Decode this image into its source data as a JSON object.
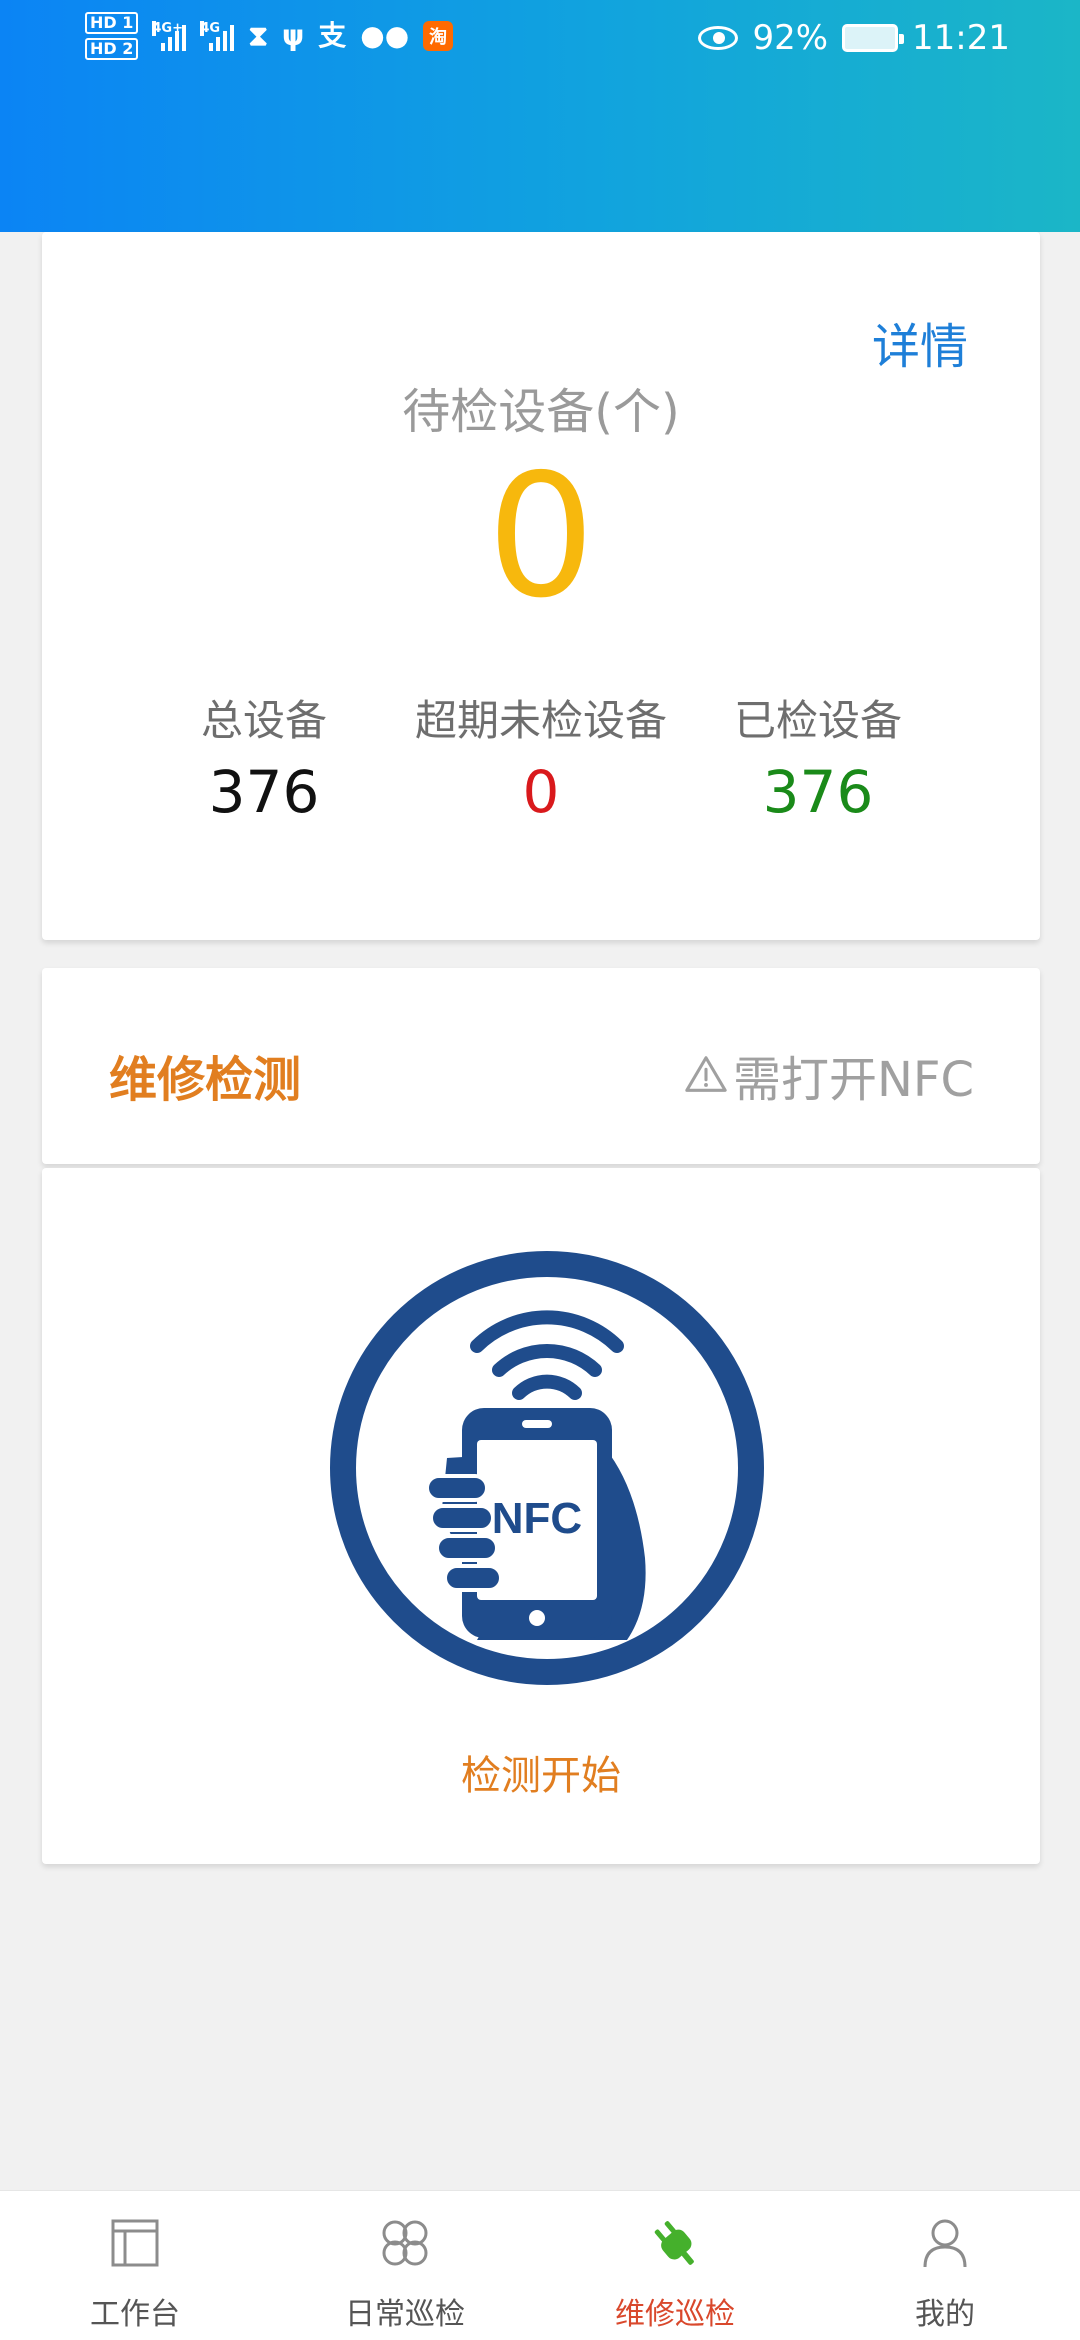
{
  "status_bar": {
    "sim1": "HD 1",
    "sim2": "HD 2",
    "signal1_label": "4G+",
    "signal2_label": "4G",
    "battery": "92%",
    "time": "11:21",
    "icons": [
      "hourglass-icon",
      "usb-icon",
      "alipay-icon",
      "wechat-icon",
      "taobao-icon",
      "eye-icon",
      "battery-icon"
    ]
  },
  "summary": {
    "detail_link": "详情",
    "pending_label": "待检设备(个)",
    "pending_value": "0",
    "stats": [
      {
        "label": "总设备",
        "value": "376"
      },
      {
        "label": "超期未检设备",
        "value": "0"
      },
      {
        "label": "已检设备",
        "value": "376"
      }
    ]
  },
  "maintenance": {
    "title": "维修检测",
    "nfc_hint": "需打开NFC",
    "nfc_logo_text": "NFC",
    "start_label": "检测开始"
  },
  "bottom_nav": {
    "items": [
      {
        "label": "工作台",
        "icon": "workbench-icon"
      },
      {
        "label": "日常巡检",
        "icon": "grid-icon"
      },
      {
        "label": "维修巡检",
        "icon": "plug-icon",
        "active": true
      },
      {
        "label": "我的",
        "icon": "user-icon"
      }
    ]
  },
  "colors": {
    "accent_orange": "#e17e20",
    "pending_yellow": "#f7b80d",
    "link_blue": "#1e7fd8",
    "overdue_red": "#d9191c",
    "done_green": "#1a8a19",
    "nfc_navy": "#1f4c8c"
  }
}
